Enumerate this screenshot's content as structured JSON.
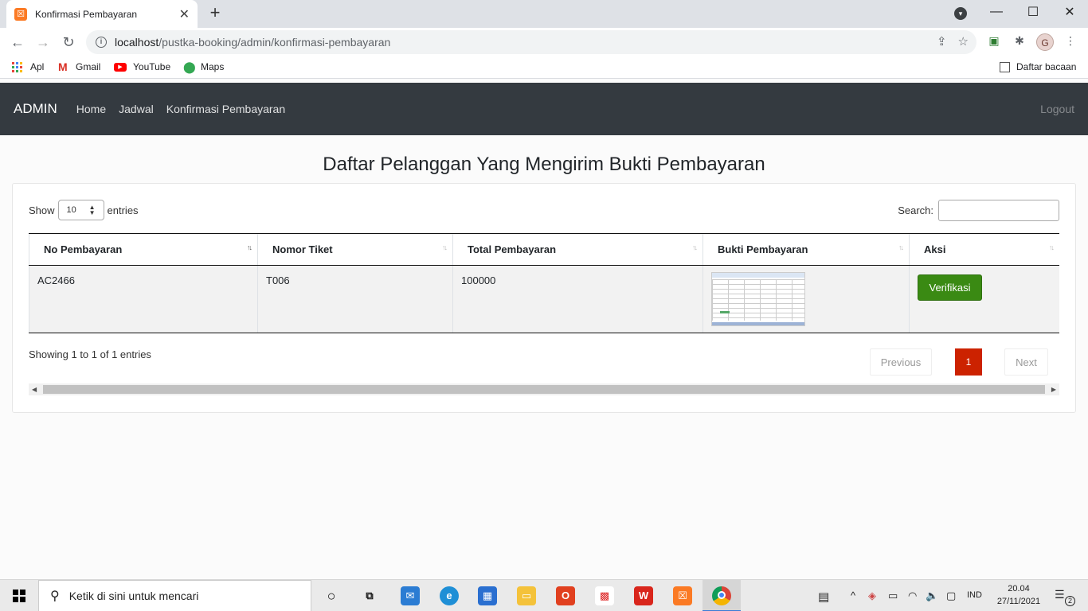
{
  "browser": {
    "tab_title": "Konfirmasi Pembayaran",
    "tab_close": "✕",
    "new_tab": "+",
    "url_host": "localhost",
    "url_path": "/pustka-booking/admin/konfirmasi-pembayaran",
    "profile_initial": "G",
    "bookmarks": [
      {
        "label": "Apl",
        "icon": "apps-icon"
      },
      {
        "label": "Gmail",
        "icon": "gmail-icon"
      },
      {
        "label": "YouTube",
        "icon": "youtube-icon"
      },
      {
        "label": "Maps",
        "icon": "maps-icon"
      }
    ],
    "reading_list": "Daftar bacaan"
  },
  "navbar": {
    "brand": "ADMIN",
    "links": [
      "Home",
      "Jadwal",
      "Konfirmasi Pembayaran"
    ],
    "logout": "Logout"
  },
  "page": {
    "heading": "Daftar Pelanggan Yang Mengirim Bukti Pembayaran"
  },
  "datatable": {
    "show_label": "Show",
    "entries_label": "entries",
    "page_length": "10",
    "search_label": "Search:",
    "search_value": "",
    "columns": [
      "No Pembayaran",
      "Nomor Tiket",
      "Total Pembayaran",
      "Bukti Pembayaran",
      "Aksi"
    ],
    "rows": [
      {
        "no_pembayaran": "AC2466",
        "nomor_tiket": "T006",
        "total_pembayaran": "100000",
        "bukti": "spreadsheet-thumbnail",
        "aksi": "Verifikasi"
      }
    ],
    "info": "Showing 1 to 1 of 1 entries",
    "previous": "Previous",
    "next": "Next",
    "current_page": "1"
  },
  "taskbar": {
    "search_placeholder": "Ketik di sini untuk mencari",
    "language": "IND",
    "time": "20.04",
    "date": "27/11/2021",
    "notification_count": "2"
  },
  "colors": {
    "navbar_bg": "#343a40",
    "verify_button": "#3a8a13",
    "active_page": "#cc2200"
  }
}
